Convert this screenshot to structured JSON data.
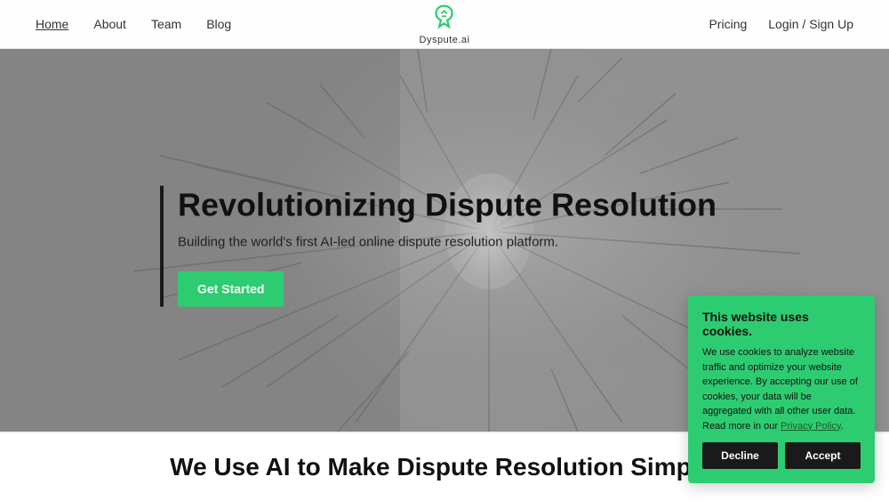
{
  "navbar": {
    "links": [
      {
        "label": "Home",
        "active": true
      },
      {
        "label": "About",
        "active": false
      },
      {
        "label": "Team",
        "active": false
      },
      {
        "label": "Blog",
        "active": false
      }
    ],
    "logo_text": "Dyspute.ai",
    "right_links": [
      {
        "label": "Pricing"
      },
      {
        "label": "Login / Sign Up"
      }
    ]
  },
  "hero": {
    "title": "Revolutionizing Dispute Resolution",
    "subtitle": "Building the world's first AI-led online dispute resolution platform.",
    "cta_label": "Get Started"
  },
  "bottom": {
    "title": "We Use AI to Make Dispute Resolution Simple."
  },
  "cookie": {
    "title": "This website uses cookies.",
    "body": "We use cookies to analyze website traffic and optimize your website experience. By accepting our use of cookies, your data will be aggregated with all other user data. Read more in our ",
    "link_text": "Privacy Policy",
    "decline_label": "Decline",
    "accept_label": "Accept"
  }
}
